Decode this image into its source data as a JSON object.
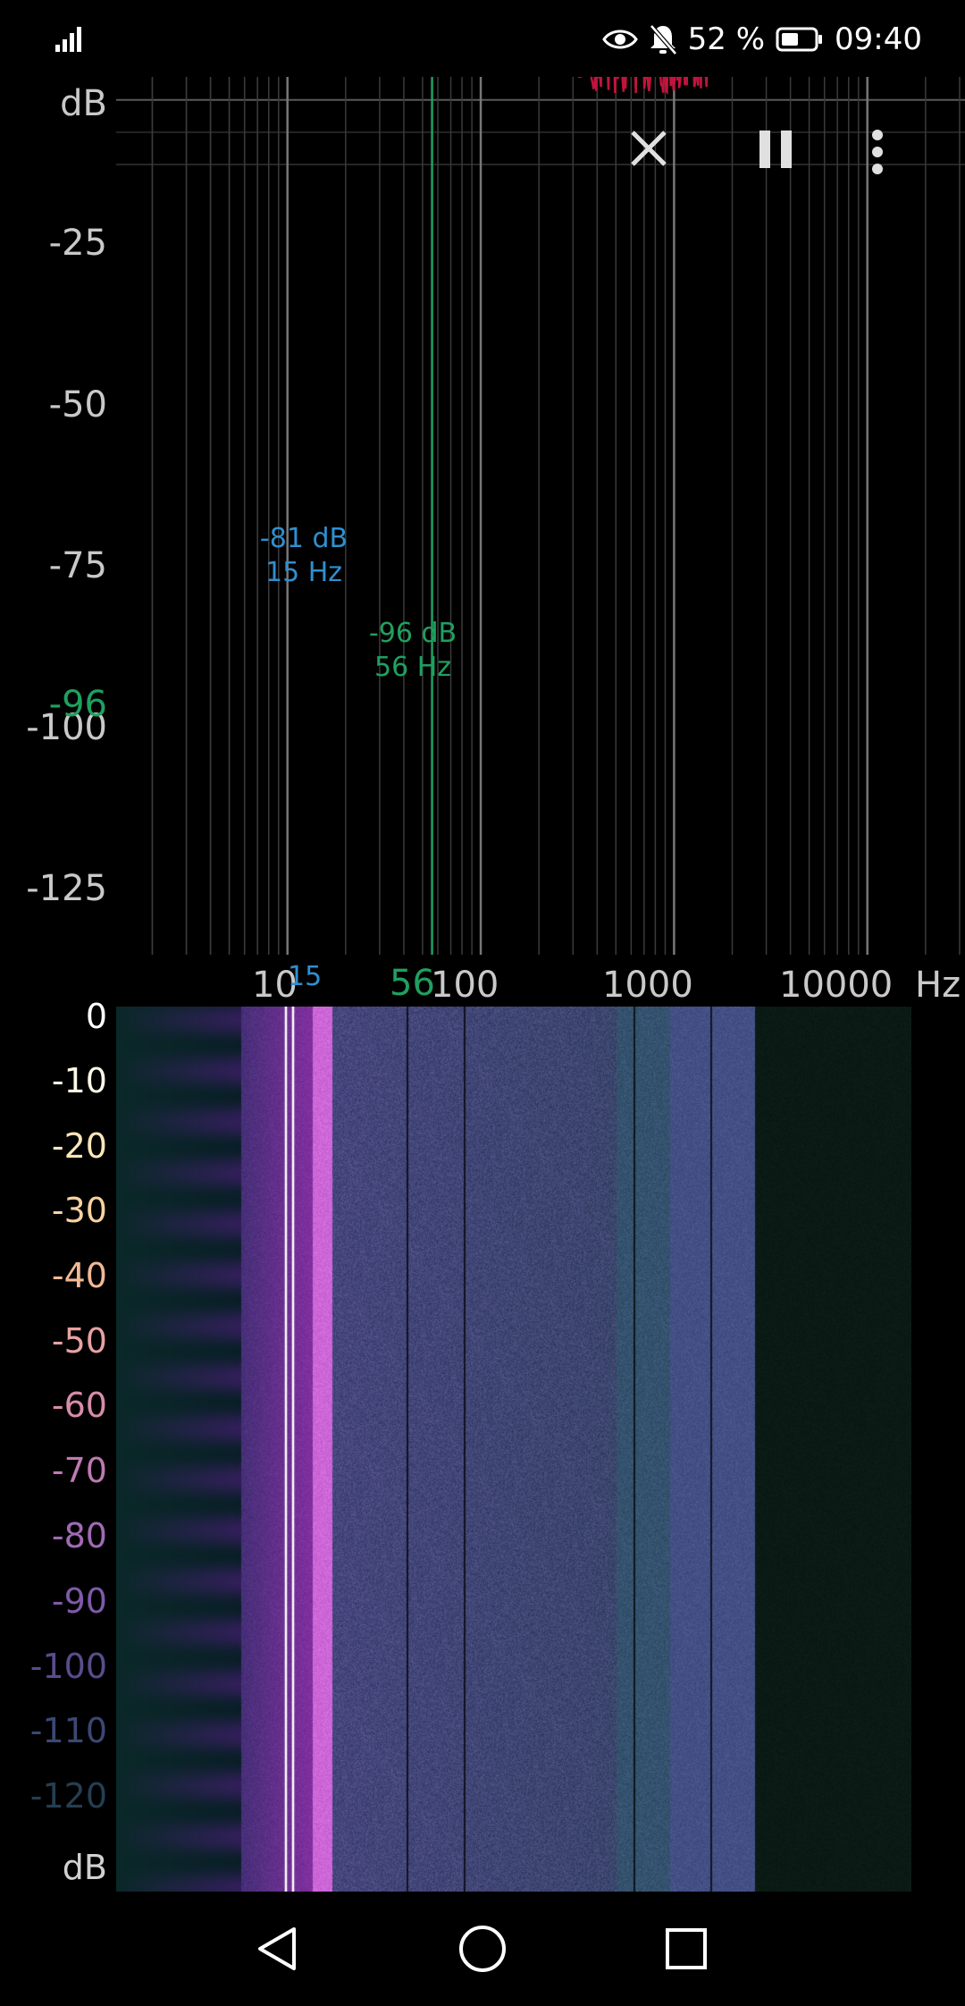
{
  "status_bar": {
    "battery_percent": "52 %",
    "time": "09:40",
    "icons": [
      "signal-icon",
      "eye-icon",
      "bell-off-icon",
      "battery-icon"
    ]
  },
  "toolbar": {
    "icons": [
      "close-icon",
      "pause-icon",
      "more-vert-icon"
    ]
  },
  "spectrum": {
    "y_unit": "dB",
    "y_ticks": [
      "-25",
      "-50",
      "-75",
      "-100",
      "-125"
    ],
    "x_unit": "Hz",
    "x_ticks": [
      "10",
      "100",
      "1000",
      "10000"
    ],
    "peak_marker": {
      "db": "-81 dB",
      "hz": "15 Hz",
      "x_value": "15",
      "color": "#2f8fd0"
    },
    "cursor_marker": {
      "db": "-96 dB",
      "hz": "56 Hz",
      "x_value": "56",
      "y_value": "-96",
      "color": "#1fa060"
    },
    "series_colors": {
      "max_hold": "#c0143c",
      "current": "#f5d000"
    }
  },
  "spectrogram": {
    "y_unit": "dB",
    "time_ticks": [
      "0",
      "-10",
      "-20",
      "-30",
      "-40",
      "-50",
      "-60",
      "-70",
      "-80",
      "-90",
      "-100",
      "-110",
      "-120"
    ],
    "cursor_color": "#ffffff"
  },
  "nav_bar": {
    "icons": [
      "back-icon",
      "home-icon",
      "recents-icon"
    ]
  }
}
